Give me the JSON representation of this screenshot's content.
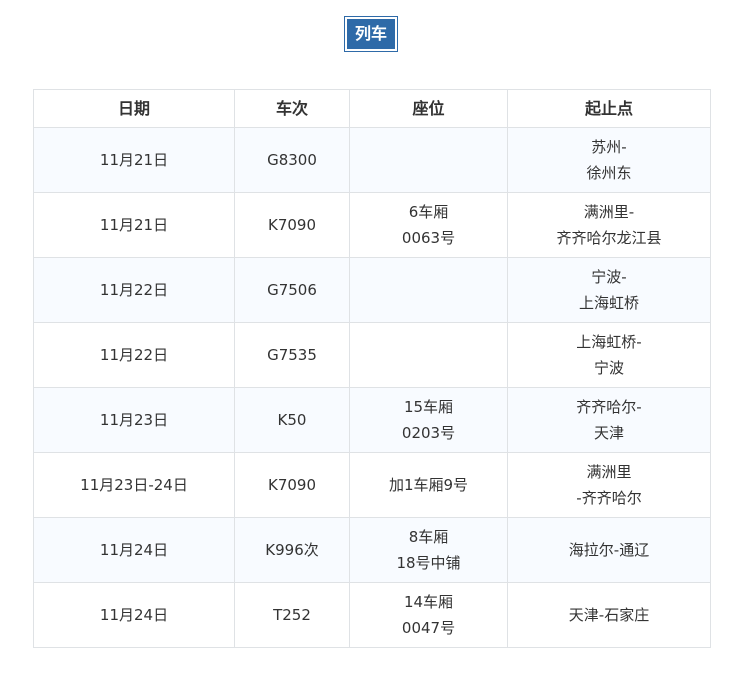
{
  "title": "列车",
  "columns": [
    "日期",
    "车次",
    "座位",
    "起止点"
  ],
  "rows": [
    {
      "date": "11月21日",
      "train": "G8300",
      "seat": [],
      "route": [
        "苏州-",
        "徐州东"
      ]
    },
    {
      "date": "11月21日",
      "train": "K7090",
      "seat": [
        "6车厢",
        "0063号"
      ],
      "route": [
        "满洲里-",
        "齐齐哈尔龙江县"
      ]
    },
    {
      "date": "11月22日",
      "train": "G7506",
      "seat": [],
      "route": [
        "宁波-",
        "上海虹桥"
      ]
    },
    {
      "date": "11月22日",
      "train": "G7535",
      "seat": [],
      "route": [
        "上海虹桥-",
        "宁波"
      ]
    },
    {
      "date": "11月23日",
      "train": "K50",
      "seat": [
        "15车厢",
        "0203号"
      ],
      "route": [
        "齐齐哈尔-",
        "天津"
      ]
    },
    {
      "date": "11月23日-24日",
      "train": "K7090",
      "seat": [
        "加1车厢9号"
      ],
      "route": [
        "满洲里",
        "-齐齐哈尔"
      ]
    },
    {
      "date": "11月24日",
      "train": "K996次",
      "seat": [
        "8车厢",
        "18号中铺"
      ],
      "route": [
        "海拉尔-通辽"
      ]
    },
    {
      "date": "11月24日",
      "train": "T252",
      "seat": [
        "14车厢",
        "0047号"
      ],
      "route": [
        "天津-石家庄"
      ]
    }
  ]
}
